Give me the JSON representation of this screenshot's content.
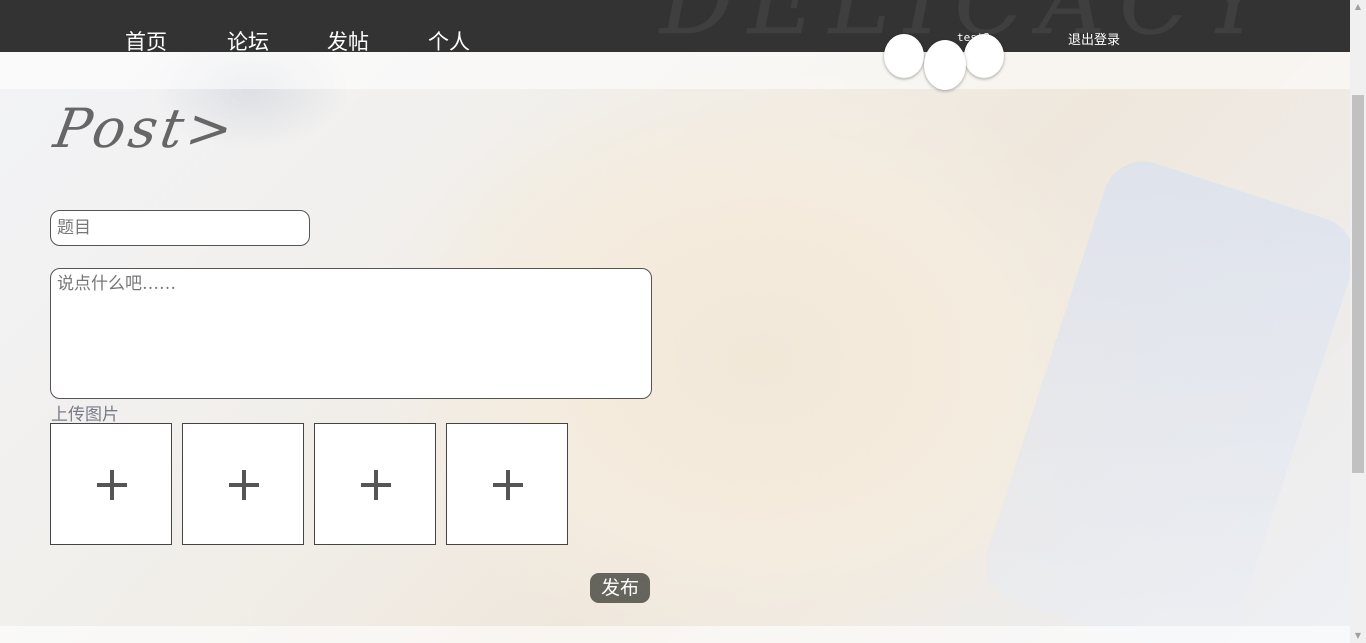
{
  "nav": {
    "items": [
      {
        "label": "首页"
      },
      {
        "label": "论坛"
      },
      {
        "label": "发帖"
      },
      {
        "label": "个人"
      }
    ],
    "brand_logo": "DELICACY",
    "username": "test2",
    "logout_label": "退出登录"
  },
  "post": {
    "heading": "Post>",
    "title_placeholder": "题目",
    "content_placeholder": "说点什么吧……",
    "upload_label": "上传图片",
    "upload_slots": [
      "+",
      "+",
      "+",
      "+"
    ],
    "submit_label": "发布"
  },
  "colors": {
    "nav_background": "#333333",
    "submit_background": "#65655d",
    "heading_color": "#666666"
  }
}
